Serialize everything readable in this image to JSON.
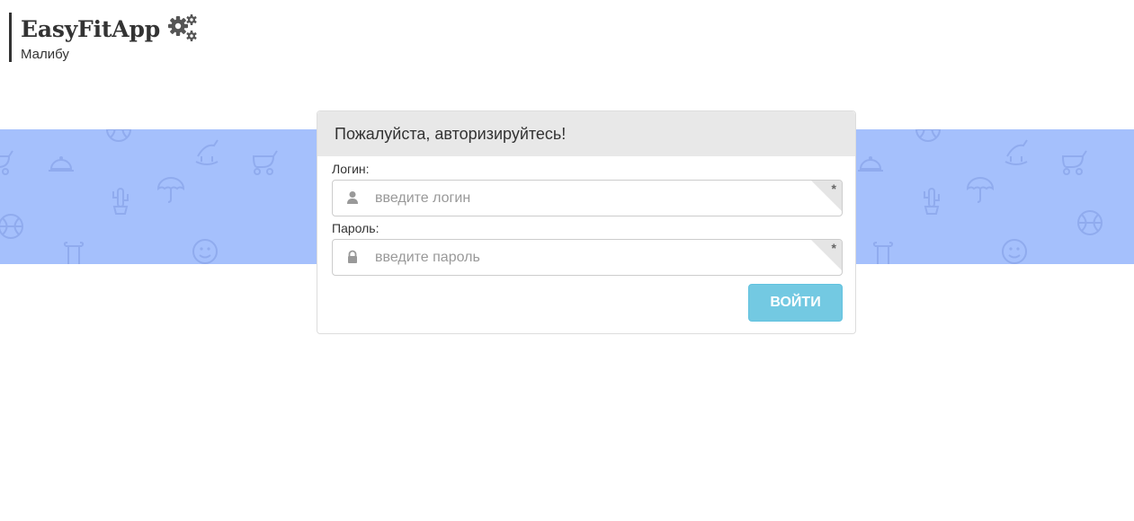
{
  "brand": {
    "name": "EasyFitApp",
    "subtitle": "Малибу",
    "icon": "gears-icon"
  },
  "band": {
    "background_color": "#a5c0fc",
    "icons": [
      "cloche-icon",
      "cactus-icon",
      "umbrella-icon",
      "ball-icon",
      "column-icon",
      "smiley-icon",
      "stroller-icon",
      "rocking-horse-icon"
    ]
  },
  "login": {
    "heading": "Пожалуйста, авторизируйтесь!",
    "login_label": "Логин:",
    "login_placeholder": "введите логин",
    "login_value": "",
    "login_icon": "user-icon",
    "password_label": "Пароль:",
    "password_placeholder": "введите пароль",
    "password_value": "",
    "password_icon": "lock-icon",
    "required_mark": "*",
    "submit_label": "ВОЙТИ",
    "accent_color": "#5bc0de"
  }
}
